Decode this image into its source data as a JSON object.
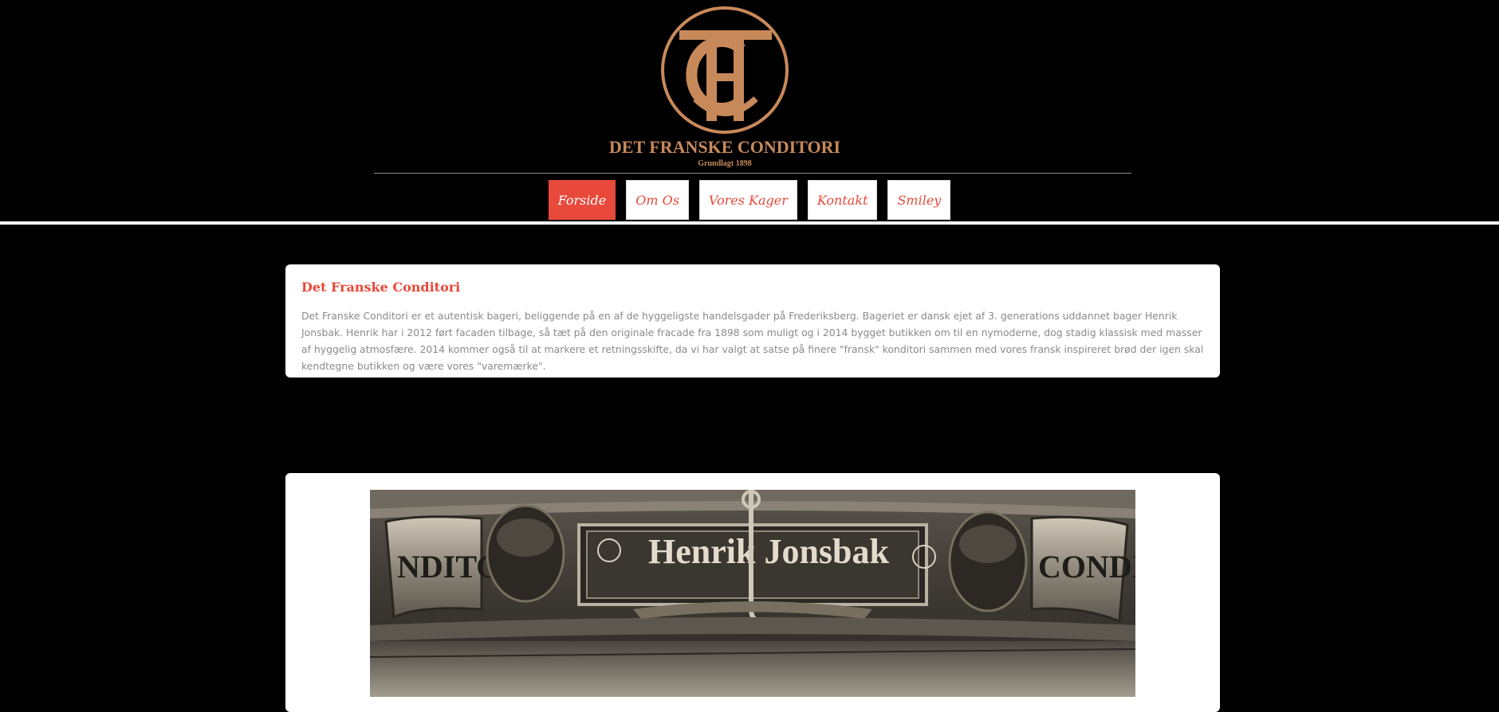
{
  "brand": {
    "logo_name": "DET FRANSKE CONDITORI",
    "logo_tagline": "Grundlagt 1898",
    "colors": {
      "gold": "#c8895a",
      "accent": "#e8493a",
      "background": "#000000"
    }
  },
  "nav": {
    "items": [
      {
        "label": "Forside",
        "active": true
      },
      {
        "label": "Om Os",
        "active": false
      },
      {
        "label": "Vores Kager",
        "active": false
      },
      {
        "label": "Kontakt",
        "active": false
      },
      {
        "label": "Smiley",
        "active": false
      }
    ]
  },
  "intro": {
    "title": "Det Franske Conditori",
    "text": "Det Franske Conditori er et autentisk bageri, beliggende på en af de hyggeligste handelsgader på Frederiksberg. Bageriet er dansk ejet af 3. generations uddannet bager Henrik Jonsbak. Henrik har i 2012 ført facaden tilbage, så tæt på den originale fracade fra 1898 som muligt og i 2014 bygget butikken om til en nymoderne, dog stadig klassisk med masser af hyggelig atmosfære. 2014 kommer også til at markere et retningsskifte, da vi har valgt at satse på finere \"fransk\" konditori sammen med vores fransk inspireret brød der igen skal kendtegne butikken og være vores \"varemærke\"."
  },
  "photo": {
    "sign_text": "Henrik Jonsbak",
    "left_text": "NDITORI",
    "right_text": "CONDI"
  }
}
